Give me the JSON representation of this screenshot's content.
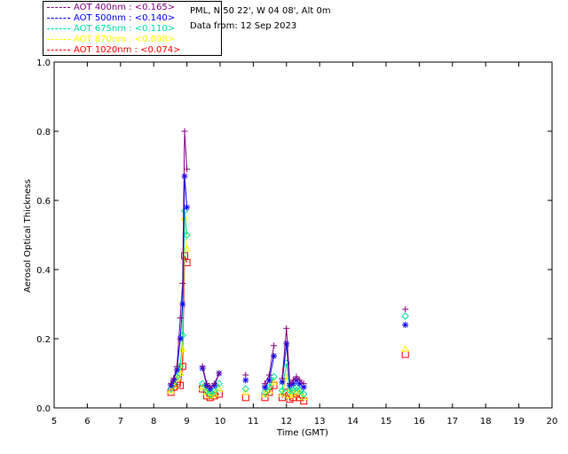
{
  "header": {
    "site": "PML, N 50 22', W 04 08', Alt 0m",
    "date": "Data from: 12 Sep 2023"
  },
  "legend": [
    {
      "label": "AOT  400nm : <0.165>",
      "color": "#7f007f"
    },
    {
      "label": "AOT  500nm : <0.140>",
      "color": "#0000ff"
    },
    {
      "label": "AOT  675nm : <0.110>",
      "color": "#00e0a0"
    },
    {
      "label": "AOT  870nm : <0.098>",
      "color": "#ffff00"
    },
    {
      "label": "AOT 1020nm : <0.074>",
      "color": "#ff0000"
    }
  ],
  "chart_data": {
    "type": "line",
    "xlabel": "Time (GMT)",
    "ylabel": "Aerosol Optical Thickness",
    "xlim": [
      5,
      20
    ],
    "ylim": [
      0.0,
      1.0
    ],
    "xticks": [
      "5",
      "6",
      "7",
      "8",
      "9",
      "10",
      "11",
      "12",
      "13",
      "14",
      "15",
      "16",
      "17",
      "18",
      "19",
      "20"
    ],
    "yticks": [
      "0.0",
      "0.2",
      "0.4",
      "0.6",
      "0.8",
      "1.0"
    ],
    "segments": [
      {
        "x": [
          8.52,
          8.6,
          8.7,
          8.8,
          8.87,
          8.93,
          9.0
        ]
      },
      {
        "x": [
          9.47,
          9.6,
          9.7,
          9.83,
          9.97
        ]
      },
      {
        "x": [
          10.77
        ]
      },
      {
        "x": [
          11.35,
          11.48,
          11.62
        ]
      },
      {
        "x": [
          11.87,
          12.0,
          12.1,
          12.2,
          12.3,
          12.4,
          12.52
        ]
      },
      {
        "x": [
          15.58
        ]
      }
    ],
    "series": [
      {
        "name": "AOT  400nm : <0.165>",
        "marker": "plus",
        "color": "#7f007f",
        "values": [
          [
            0.07,
            0.085,
            0.12,
            0.26,
            0.36,
            0.8,
            0.69
          ],
          [
            0.12,
            0.07,
            0.06,
            0.07,
            0.1
          ],
          [
            0.095
          ],
          [
            0.07,
            0.095,
            0.18
          ],
          [
            0.085,
            0.23,
            0.07,
            0.08,
            0.09,
            0.08,
            0.07
          ],
          [
            0.285
          ]
        ]
      },
      {
        "name": "AOT  500nm : <0.140>",
        "marker": "star",
        "color": "#0000ff",
        "values": [
          [
            0.065,
            0.08,
            0.11,
            0.2,
            0.3,
            0.67,
            0.58
          ],
          [
            0.115,
            0.065,
            0.055,
            0.065,
            0.1
          ],
          [
            0.08
          ],
          [
            0.06,
            0.08,
            0.15
          ],
          [
            0.075,
            0.185,
            0.065,
            0.07,
            0.08,
            0.07,
            0.06
          ],
          [
            0.24
          ]
        ]
      },
      {
        "name": "AOT  675nm : <0.110>",
        "marker": "diamond",
        "color": "#00e0a0",
        "values": [
          [
            0.055,
            0.07,
            0.09,
            0.12,
            0.21,
            0.57,
            0.5
          ],
          [
            0.07,
            0.05,
            0.04,
            0.05,
            0.07
          ],
          [
            0.055
          ],
          [
            0.045,
            0.06,
            0.09
          ],
          [
            0.05,
            0.13,
            0.05,
            0.05,
            0.06,
            0.05,
            0.04
          ],
          [
            0.265
          ]
        ]
      },
      {
        "name": "AOT  870nm : <0.098>",
        "marker": "triangle",
        "color": "#ffff00",
        "values": [
          [
            0.05,
            0.065,
            0.085,
            0.1,
            0.17,
            0.55,
            0.46
          ],
          [
            0.06,
            0.045,
            0.035,
            0.04,
            0.055
          ],
          [
            0.045
          ],
          [
            0.04,
            0.05,
            0.075
          ],
          [
            0.04,
            0.09,
            0.035,
            0.04,
            0.05,
            0.045,
            0.03
          ],
          [
            0.17
          ]
        ]
      },
      {
        "name": "AOT 1020nm : <0.074>",
        "marker": "square",
        "color": "#ff0000",
        "values": [
          [
            0.045,
            0.06,
            0.07,
            0.065,
            0.12,
            0.44,
            0.42
          ],
          [
            0.055,
            0.035,
            0.03,
            0.035,
            0.04
          ],
          [
            0.03
          ],
          [
            0.03,
            0.045,
            0.065
          ],
          [
            0.03,
            0.045,
            0.025,
            0.03,
            0.04,
            0.03,
            0.02
          ],
          [
            0.155
          ]
        ]
      }
    ]
  }
}
